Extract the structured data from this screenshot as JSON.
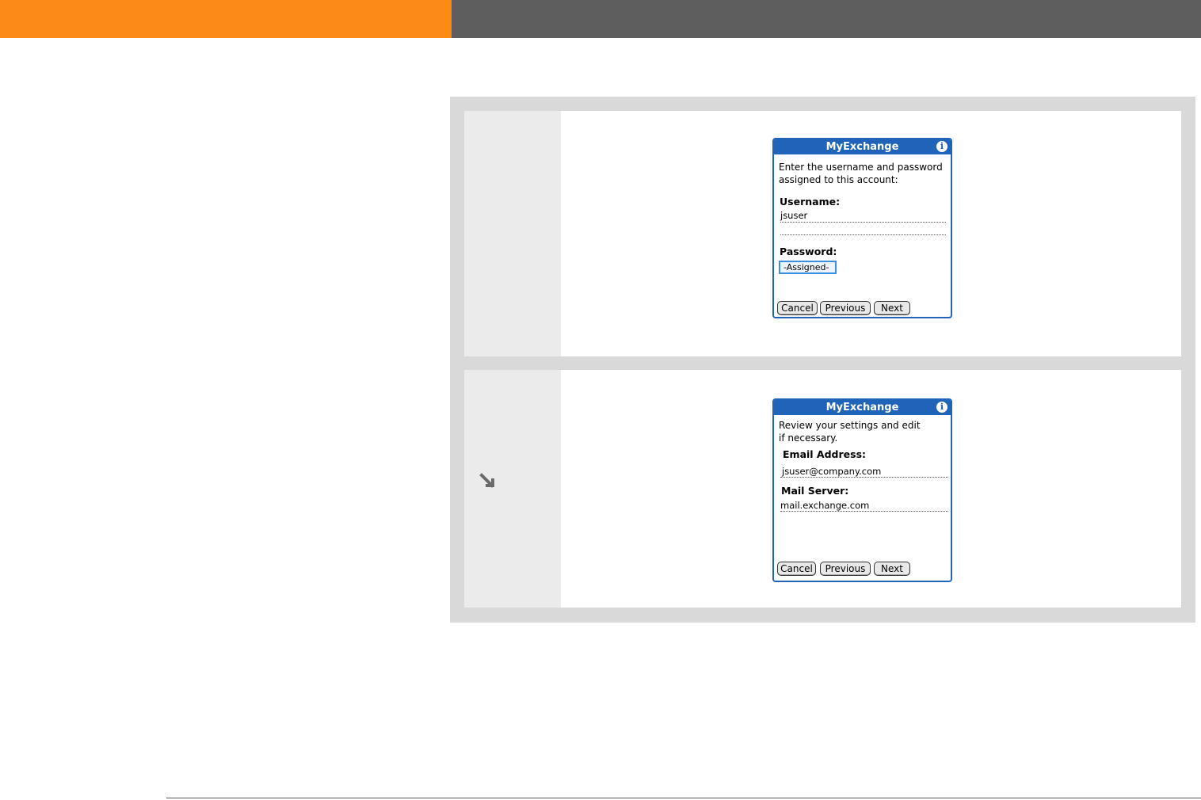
{
  "dialog1": {
    "title": "MyExchange",
    "instructions_line1": "Enter the username and password",
    "instructions_line2": "assigned to this account:",
    "username_label": "Username:",
    "username_value": "jsuser",
    "password_label": "Password:",
    "password_value": "-Assigned-",
    "buttons": {
      "cancel": "Cancel",
      "previous": "Previous",
      "next": "Next"
    }
  },
  "dialog2": {
    "title": "MyExchange",
    "instructions_line1": "Review your settings and edit",
    "instructions_line2": "if necessary.",
    "email_label": "Email Address:",
    "email_value": "jsuser@company.com",
    "server_label": "Mail Server:",
    "server_value": "mail.exchange.com",
    "buttons": {
      "cancel": "Cancel",
      "previous": "Previous",
      "next": "Next"
    }
  },
  "icons": {
    "info": "info-icon",
    "arrow": "arrow-down-right-icon"
  },
  "colors": {
    "orange_bar": "#fb8a16",
    "gray_bar": "#5e5e5e",
    "dialog_blue": "#1f64b8"
  }
}
